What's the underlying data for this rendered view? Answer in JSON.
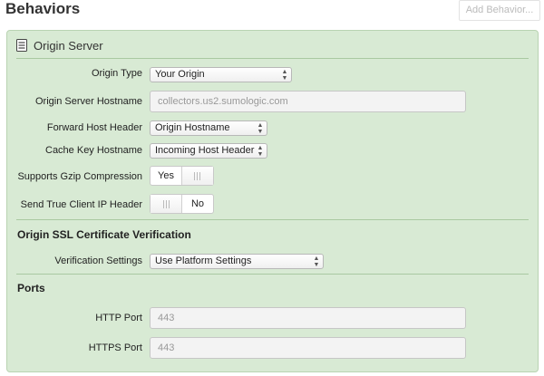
{
  "header": {
    "title": "Behaviors",
    "add_behavior_label": "Add Behavior..."
  },
  "panel": {
    "title": "Origin Server",
    "title_icon": "document-icon",
    "background_color": "#d8ead4"
  },
  "fields": {
    "origin_type": {
      "label": "Origin Type",
      "value": "Your Origin"
    },
    "origin_hostname": {
      "label": "Origin Server Hostname",
      "placeholder": "collectors.us2.sumologic.com"
    },
    "forward_host_header": {
      "label": "Forward Host Header",
      "value": "Origin Hostname"
    },
    "cache_key_hostname": {
      "label": "Cache Key Hostname",
      "value": "Incoming Host Header"
    },
    "gzip": {
      "label": "Supports Gzip Compression",
      "on_label": "Yes",
      "state": "on"
    },
    "true_client_ip": {
      "label": "Send True Client IP Header",
      "off_label": "No",
      "state": "off"
    }
  },
  "ssl": {
    "title": "Origin SSL Certificate Verification",
    "verification": {
      "label": "Verification Settings",
      "value": "Use Platform Settings"
    }
  },
  "ports": {
    "title": "Ports",
    "http": {
      "label": "HTTP Port",
      "placeholder": "443"
    },
    "https": {
      "label": "HTTPS Port",
      "placeholder": "443"
    }
  }
}
